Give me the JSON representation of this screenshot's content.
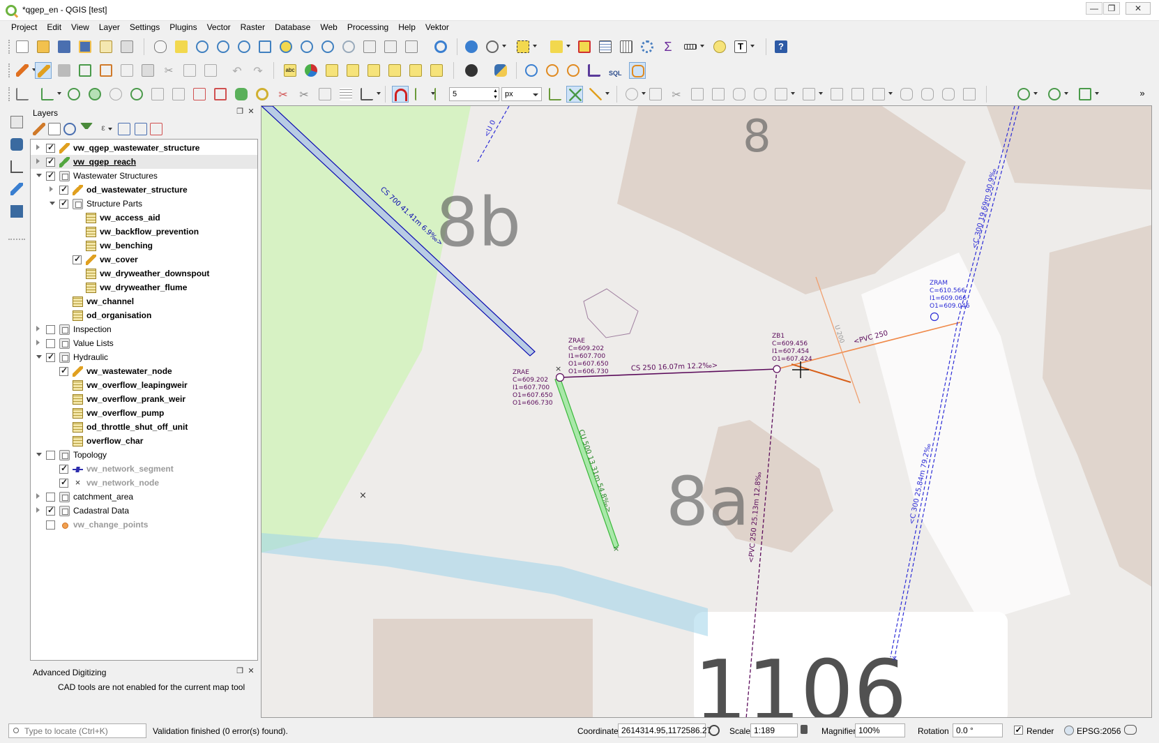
{
  "window": {
    "title": "*qgep_en - QGIS [test]",
    "minimize": "—",
    "maximize": "❐",
    "close": "✕"
  },
  "menu": [
    "Project",
    "Edit",
    "View",
    "Layer",
    "Settings",
    "Plugins",
    "Vector",
    "Raster",
    "Database",
    "Web",
    "Processing",
    "Help",
    "Vektor"
  ],
  "digitize_toolbar": {
    "tolerance_value": "5",
    "tolerance_unit": "px"
  },
  "layers_panel": {
    "title": "Layers",
    "float_icon": "❐",
    "close_icon": "✕",
    "tree": [
      {
        "label": "vw_qgep_wastewater_structure",
        "level": 0,
        "expander": "closed",
        "checked": true,
        "icon": "pencil",
        "bold": true,
        "underline": false,
        "grey": false,
        "selected": false
      },
      {
        "label": "vw_qgep_reach",
        "level": 0,
        "expander": "closed",
        "checked": true,
        "icon": "pencil2",
        "bold": true,
        "underline": true,
        "grey": false,
        "selected": true
      },
      {
        "label": "Wastewater Structures",
        "level": 0,
        "expander": "open",
        "checked": true,
        "icon": "grp",
        "bold": false,
        "underline": false,
        "grey": false,
        "selected": false
      },
      {
        "label": "od_wastewater_structure",
        "level": 1,
        "expander": "closed",
        "checked": true,
        "icon": "pencil",
        "bold": true,
        "underline": false,
        "grey": false,
        "selected": false
      },
      {
        "label": "Structure Parts",
        "level": 1,
        "expander": "open",
        "checked": true,
        "icon": "grp",
        "bold": false,
        "underline": false,
        "grey": false,
        "selected": false
      },
      {
        "label": "vw_access_aid",
        "level": 2,
        "expander": "none",
        "checked": null,
        "icon": "table",
        "bold": true,
        "underline": false,
        "grey": false,
        "selected": false
      },
      {
        "label": "vw_backflow_prevention",
        "level": 2,
        "expander": "none",
        "checked": null,
        "icon": "table",
        "bold": true,
        "underline": false,
        "grey": false,
        "selected": false
      },
      {
        "label": "vw_benching",
        "level": 2,
        "expander": "none",
        "checked": null,
        "icon": "table",
        "bold": true,
        "underline": false,
        "grey": false,
        "selected": false
      },
      {
        "label": "vw_cover",
        "level": 2,
        "expander": "none",
        "checked": true,
        "icon": "pencil",
        "bold": true,
        "underline": false,
        "grey": false,
        "selected": false
      },
      {
        "label": "vw_dryweather_downspout",
        "level": 2,
        "expander": "none",
        "checked": null,
        "icon": "table",
        "bold": true,
        "underline": false,
        "grey": false,
        "selected": false
      },
      {
        "label": "vw_dryweather_flume",
        "level": 2,
        "expander": "none",
        "checked": null,
        "icon": "table",
        "bold": true,
        "underline": false,
        "grey": false,
        "selected": false
      },
      {
        "label": "vw_channel",
        "level": 1,
        "expander": "none",
        "checked": null,
        "icon": "table",
        "bold": true,
        "underline": false,
        "grey": false,
        "selected": false
      },
      {
        "label": "od_organisation",
        "level": 1,
        "expander": "none",
        "checked": null,
        "icon": "table",
        "bold": true,
        "underline": false,
        "grey": false,
        "selected": false
      },
      {
        "label": "Inspection",
        "level": 0,
        "expander": "closed",
        "checked": false,
        "icon": "grp",
        "bold": false,
        "underline": false,
        "grey": false,
        "selected": false
      },
      {
        "label": "Value Lists",
        "level": 0,
        "expander": "closed",
        "checked": false,
        "icon": "grp",
        "bold": false,
        "underline": false,
        "grey": false,
        "selected": false
      },
      {
        "label": "Hydraulic",
        "level": 0,
        "expander": "open",
        "checked": true,
        "icon": "grp",
        "bold": false,
        "underline": false,
        "grey": false,
        "selected": false
      },
      {
        "label": "vw_wastewater_node",
        "level": 1,
        "expander": "none",
        "checked": true,
        "icon": "pencil",
        "bold": true,
        "underline": false,
        "grey": false,
        "selected": false
      },
      {
        "label": "vw_overflow_leapingweir",
        "level": 1,
        "expander": "none",
        "checked": null,
        "icon": "table",
        "bold": true,
        "underline": false,
        "grey": false,
        "selected": false
      },
      {
        "label": "vw_overflow_prank_weir",
        "level": 1,
        "expander": "none",
        "checked": null,
        "icon": "table",
        "bold": true,
        "underline": false,
        "grey": false,
        "selected": false
      },
      {
        "label": "vw_overflow_pump",
        "level": 1,
        "expander": "none",
        "checked": null,
        "icon": "table",
        "bold": true,
        "underline": false,
        "grey": false,
        "selected": false
      },
      {
        "label": "od_throttle_shut_off_unit",
        "level": 1,
        "expander": "none",
        "checked": null,
        "icon": "table",
        "bold": true,
        "underline": false,
        "grey": false,
        "selected": false
      },
      {
        "label": "overflow_char",
        "level": 1,
        "expander": "none",
        "checked": null,
        "icon": "table",
        "bold": true,
        "underline": false,
        "grey": false,
        "selected": false
      },
      {
        "label": "Topology",
        "level": 0,
        "expander": "open",
        "checked": false,
        "icon": "grp",
        "bold": false,
        "underline": false,
        "grey": false,
        "selected": false
      },
      {
        "label": "vw_network_segment",
        "level": 1,
        "expander": "none",
        "checked": true,
        "icon": "linesym",
        "bold": true,
        "underline": false,
        "grey": true,
        "selected": false
      },
      {
        "label": "vw_network_node",
        "level": 1,
        "expander": "none",
        "checked": true,
        "icon": "xsym",
        "bold": true,
        "underline": false,
        "grey": true,
        "selected": false
      },
      {
        "label": "catchment_area",
        "level": 0,
        "expander": "closed",
        "checked": false,
        "icon": "grp",
        "bold": false,
        "underline": false,
        "grey": false,
        "selected": false
      },
      {
        "label": "Cadastral Data",
        "level": 0,
        "expander": "closed",
        "checked": true,
        "icon": "grp",
        "bold": false,
        "underline": false,
        "grey": false,
        "selected": false
      },
      {
        "label": "vw_change_points",
        "level": 0,
        "expander": "none",
        "checked": false,
        "icon": "dot",
        "bold": true,
        "underline": false,
        "grey": true,
        "selected": false
      }
    ]
  },
  "advanced_digitizing": {
    "title": "Advanced Digitizing",
    "message": "CAD tools are not enabled for the current map tool"
  },
  "map": {
    "building_labels": [
      "8",
      "8b",
      "8a",
      "1106"
    ],
    "reach_labels": {
      "cs700": "CS 700 41.41m 6.9‰>",
      "cs250": "CS 250 16.07m 12.2‰>",
      "cu500": "CU 500 13.31m 54.8‰>",
      "pvc250_a": "<PVC 250 25.13m 12.8‰",
      "pvc250_b": "<PVC 250",
      "c300_a": "<C 300 19.69m 90.9‰",
      "c300_b": "<C 300 25.84m 79.2‰",
      "u200": "U 200",
      "u0": "<U 0"
    },
    "nodes": {
      "zrae_left": [
        "ZRAE",
        "C=609.202",
        "I1=607.700",
        "O1=607.650",
        "O1=606.730"
      ],
      "zrae_top": [
        "ZRAE",
        "C=609.202",
        "I1=607.700",
        "O1=607.650",
        "O1=606.730"
      ],
      "zb1": [
        "ZB1",
        "C=609.456",
        "I1=607.454",
        "O1=607.424"
      ],
      "zram": [
        "ZRAM",
        "C=610.566",
        "I1=609.066",
        "O1=609.046"
      ]
    }
  },
  "statusbar": {
    "locator_placeholder": "Type to locate (Ctrl+K)",
    "message": "Validation finished (0 error(s) found).",
    "coordinate_label": "Coordinate",
    "coordinate_value": "2614314.95,1172586.27",
    "scale_label": "Scale",
    "scale_value": "1:189",
    "magnifier_label": "Magnifier",
    "magnifier_value": "100%",
    "rotation_label": "Rotation",
    "rotation_value": "0.0 °",
    "render_label": "Render",
    "crs": "EPSG:2056"
  },
  "colors": {
    "reach_purple": "#5a0a5a",
    "reach_blue": "#0b0bb0",
    "reach_green": "#39b839",
    "reach_orange": "#f08a4a",
    "reach_blue_dashed": "#2b2bd6",
    "park_green": "#d7f2c4",
    "building": "#dccfc5"
  }
}
